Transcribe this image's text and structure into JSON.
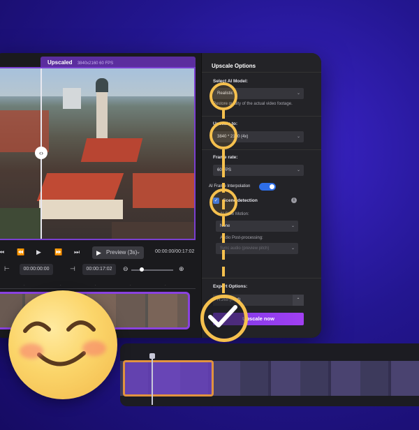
{
  "preview": {
    "tag_label": "Upscaled",
    "tag_detail": "3840x2160 60 FPS",
    "preview_button": "Preview (3s)",
    "timecode": "00:00:00/00:17:02",
    "trim_start": "00:00:00:00",
    "trim_end": "00:00:17:02"
  },
  "panel": {
    "title": "Upscale Options",
    "ai_model_label": "Select AI Model:",
    "ai_model_value": "Realistic",
    "ai_model_hint": "Restore quality of the actual video footage.",
    "resolution_label": "Upscale to:",
    "resolution_value": "3840 * 2160 (4x)",
    "frame_rate_label": "Frame rate:",
    "frame_rate_value": "60 FPS",
    "interpolation_label": "AI Frame Interpolation",
    "scene_detection_label": "Scene detection",
    "slow_motion_label": "AI Slow Motion:",
    "slow_motion_value": "None",
    "post_processing_label": "Audio Post-processing:",
    "post_processing_value": "Sync audio (preview pitch)",
    "export_label": "Export Options:",
    "codec_value": "H.265 (mp4)",
    "upscale_button": "Upscale now"
  },
  "icons": {
    "play": "▶",
    "prev": "⏮",
    "next": "⏭",
    "step_back": "⏪",
    "step_fwd": "⏩",
    "chevron": "⌄",
    "zoom": "⊕"
  },
  "colors": {
    "accent": "#8a42e0",
    "highlight": "#f5c04e",
    "toggle": "#2e6ee8"
  }
}
